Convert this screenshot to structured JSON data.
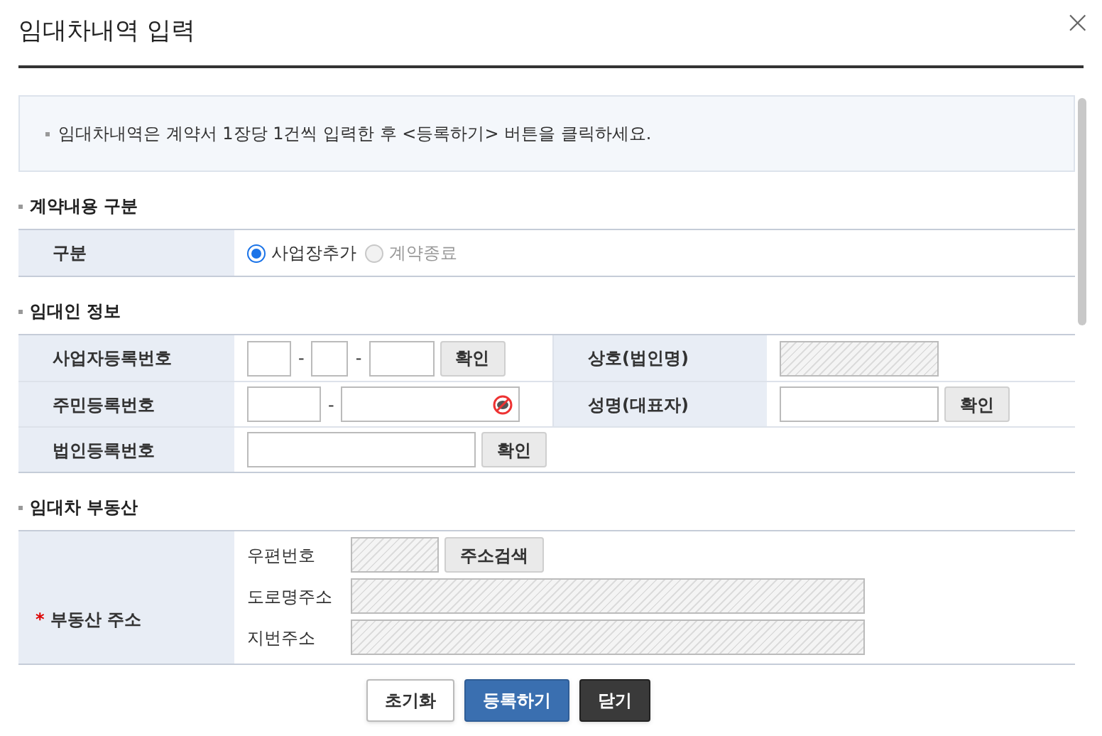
{
  "dialog": {
    "title": "임대차내역 입력",
    "close": "×"
  },
  "notice": "임대차내역은 계약서 1장당 1건씩 입력한 후 <등록하기> 버튼을 클릭하세요.",
  "sections": [
    {
      "title": "계약내용 구분",
      "kind": "simple",
      "rows": [
        {
          "label": "구분",
          "fields": [
            {
              "kind": "radio",
              "label": "사업장추가",
              "selected": true,
              "disabled": false
            },
            {
              "kind": "radio",
              "label": "계약종료",
              "selected": false,
              "disabled": true
            }
          ]
        }
      ]
    },
    {
      "title": "임대인 정보",
      "kind": "split",
      "rows": [
        {
          "label": "사업자등록번호",
          "fields": [
            {
              "kind": "box_s",
              "disabled": false
            },
            {
              "kind": "separator",
              "text": "-"
            },
            {
              "kind": "box_xs",
              "disabled": false
            },
            {
              "kind": "separator",
              "text": "-"
            },
            {
              "kind": "box_m",
              "disabled": false
            },
            {
              "kind": "button",
              "label": "확인"
            }
          ],
          "label_2": "상호(법인명)",
          "fields_2": [
            {
              "kind": "box_l",
              "disabled": true
            }
          ]
        },
        {
          "label": "주민등록번호",
          "fields": [
            {
              "kind": "box_m2",
              "disabled": false
            },
            {
              "kind": "separator",
              "text": "-"
            },
            {
              "kind": "masked",
              "disabled": false
            }
          ],
          "label_2": "성명(대표자)",
          "fields_2": [
            {
              "kind": "box_l",
              "disabled": false
            },
            {
              "kind": "button",
              "label": "확인"
            }
          ]
        },
        {
          "label": "법인등록번호",
          "fields": [
            {
              "kind": "box_xl",
              "disabled": false
            },
            {
              "kind": "button",
              "label": "확인"
            }
          ]
        }
      ]
    },
    {
      "title": "임대차 부동산",
      "kind": "address",
      "rows": [
        {
          "label": "부동산 주소",
          "required": true,
          "required_mark": "*",
          "lines": [
            {
              "label": "우편번호",
              "fields": [
                {
                  "kind": "box_zip",
                  "disabled": true
                },
                {
                  "kind": "button",
                  "label": "주소검색"
                }
              ]
            },
            {
              "label": "도로명주소",
              "fields": [
                {
                  "kind": "box_xxl",
                  "disabled": true
                }
              ]
            },
            {
              "label": "지번주소",
              "fields": [
                {
                  "kind": "box_xxl",
                  "disabled": true
                }
              ]
            }
          ]
        }
      ]
    }
  ],
  "buttons": [
    {
      "label": "초기화",
      "kind": "reset"
    },
    {
      "label": "등록하기",
      "kind": "primary"
    },
    {
      "label": "닫기",
      "kind": "dark"
    }
  ]
}
